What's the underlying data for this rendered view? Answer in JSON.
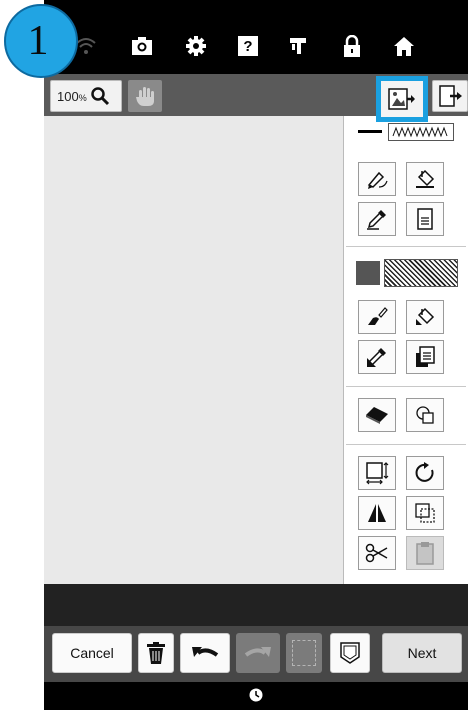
{
  "step_badge": {
    "number": "1"
  },
  "topbar": {
    "icons": [
      "wifi-icon",
      "camera-icon",
      "gear-icon",
      "help-icon",
      "sewing-machine-icon",
      "lock-icon",
      "home-icon"
    ],
    "help_glyph": "?"
  },
  "toolrow": {
    "zoom_percent": "100",
    "zoom_unit": "%"
  },
  "panel": {
    "line_tools": [
      "line-pen-tool",
      "line-fill-tool",
      "line-eyedropper-tool",
      "line-stitch-tool"
    ],
    "region_tools": [
      "region-brush-tool",
      "region-fill-tool",
      "region-eyedropper-tool",
      "region-stitch-tool"
    ],
    "edit_tools": [
      "eraser-tool",
      "shape-tool"
    ],
    "transform_tools": [
      "resize-tool",
      "rotate-tool",
      "flip-tool",
      "duplicate-tool",
      "cut-tool",
      "paste-tool"
    ],
    "fill_color": "#555555",
    "line_color": "#000000",
    "accent": "#1aa0e0"
  },
  "actions": {
    "cancel_label": "Cancel",
    "next_label": "Next"
  }
}
